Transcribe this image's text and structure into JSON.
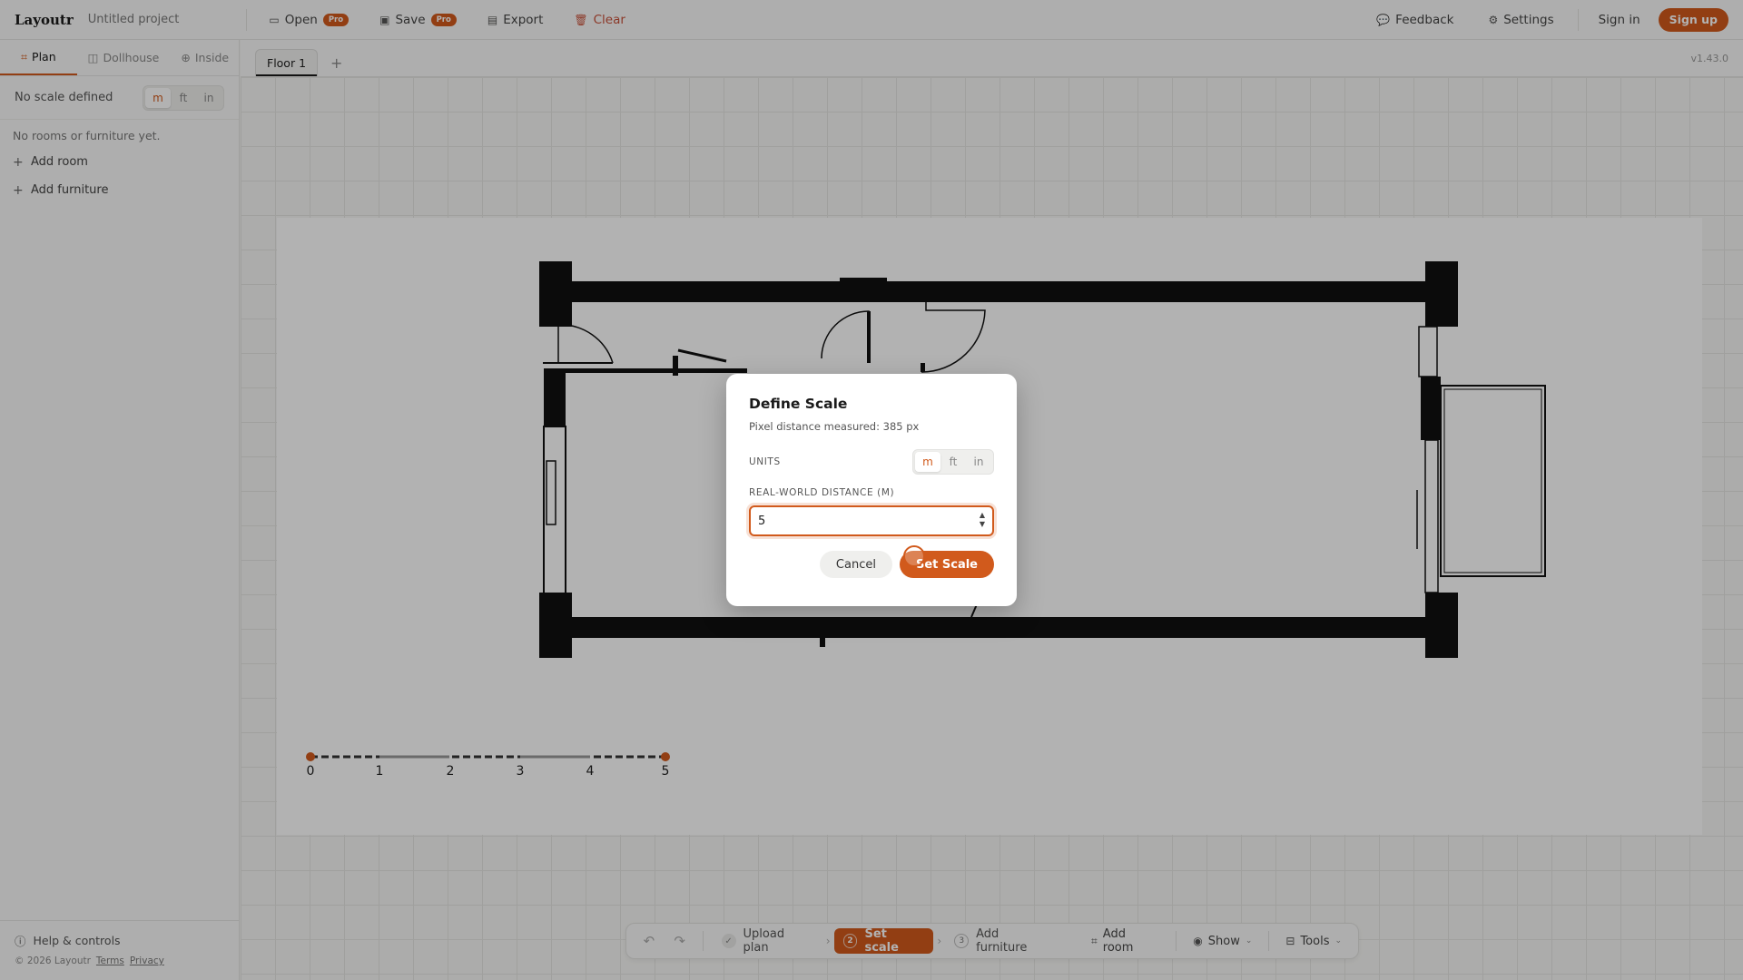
{
  "app": {
    "brand": "Layoutr",
    "project_title": "Untitled project",
    "version": "v1.43.0"
  },
  "toolbar": {
    "open_label": "Open",
    "save_label": "Save",
    "pro_badge": "Pro",
    "export_label": "Export",
    "clear_label": "Clear",
    "feedback_label": "Feedback",
    "settings_label": "Settings",
    "signin_label": "Sign in",
    "signup_label": "Sign up"
  },
  "sidebar": {
    "tabs": [
      {
        "label": "Plan",
        "active": true
      },
      {
        "label": "Dollhouse",
        "active": false
      },
      {
        "label": "Inside",
        "active": false
      }
    ],
    "scale_status": "No scale defined",
    "units": [
      "m",
      "ft",
      "in"
    ],
    "selected_unit": "m",
    "empty_message": "No rooms or furniture yet.",
    "add_room_label": "Add room",
    "add_furniture_label": "Add furniture",
    "help_label": "Help & controls",
    "copyright": "© 2026 Layoutr",
    "terms_label": "Terms",
    "privacy_label": "Privacy"
  },
  "floors": {
    "tabs": [
      "Floor 1"
    ],
    "add_label": "+"
  },
  "scale_ruler": {
    "ticks": [
      "0",
      "1",
      "2",
      "3",
      "4",
      "5"
    ]
  },
  "bottom_toolbar": {
    "steps": [
      {
        "label": "Upload plan",
        "state": "done",
        "num": ""
      },
      {
        "label": "Set scale",
        "state": "current",
        "num": "2"
      },
      {
        "label": "Add furniture",
        "state": "todo",
        "num": "3"
      }
    ],
    "add_room_label": "Add room",
    "show_label": "Show",
    "tools_label": "Tools"
  },
  "dialog": {
    "title": "Define Scale",
    "measured_text": "Pixel distance measured: 385 px",
    "units_label": "UNITS",
    "units": [
      "m",
      "ft",
      "in"
    ],
    "selected_unit": "m",
    "distance_label": "REAL-WORLD DISTANCE (M)",
    "distance_value": "5",
    "cancel_label": "Cancel",
    "confirm_label": "Set Scale"
  },
  "colors": {
    "accent": "#d15a1c",
    "danger": "#c8513a",
    "wall": "#111111"
  }
}
